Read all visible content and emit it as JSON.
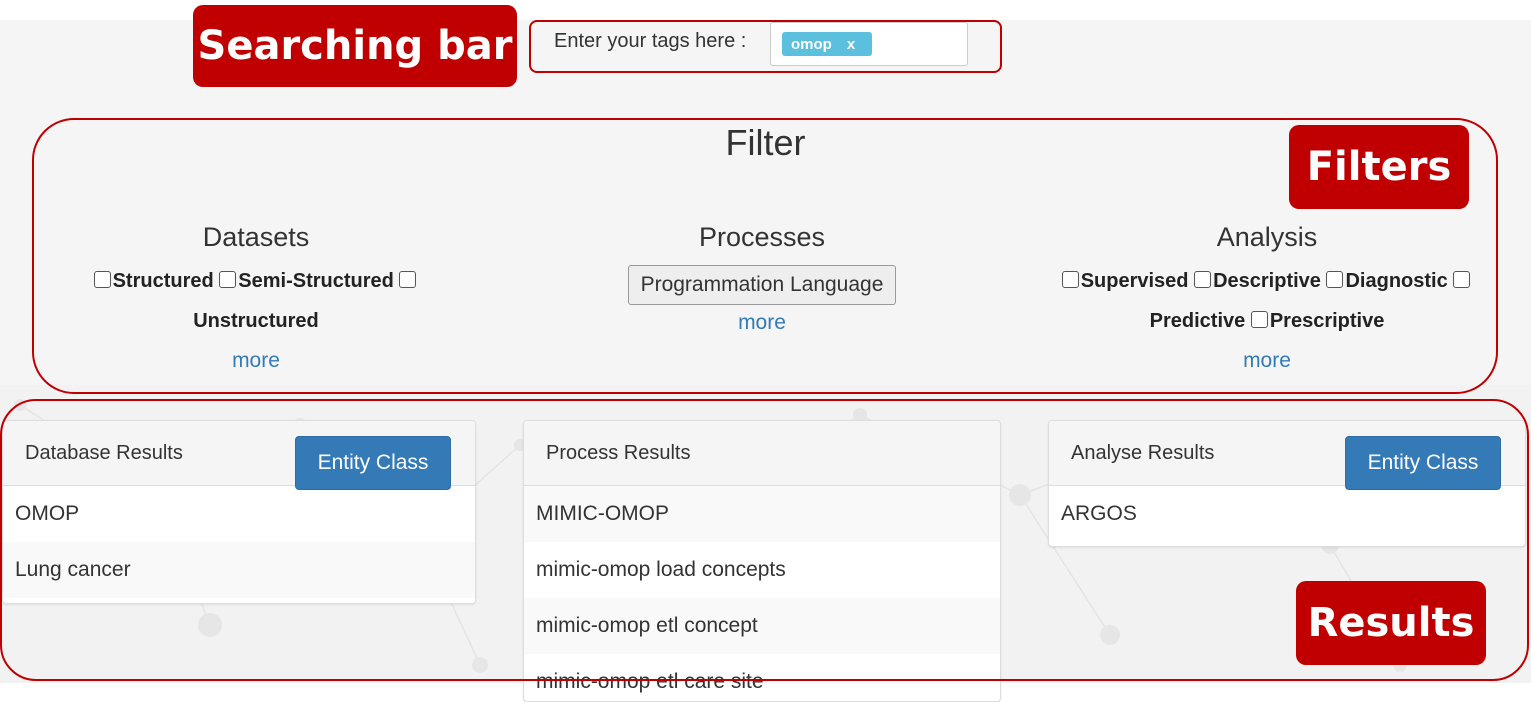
{
  "annotations": {
    "search_label": "Searching bar",
    "filters_label": "Filters",
    "results_label": "Results"
  },
  "search": {
    "prompt": "Enter your tags here :",
    "tags": [
      {
        "label": "omop",
        "remove": "x"
      }
    ]
  },
  "filter": {
    "title": "Filter",
    "datasets": {
      "title": "Datasets",
      "options": [
        "Structured",
        "Semi-Structured",
        "Unstructured"
      ],
      "more": "more"
    },
    "processes": {
      "title": "Processes",
      "button": "Programmation Language",
      "more": "more"
    },
    "analysis": {
      "title": "Analysis",
      "options": [
        "Supervised",
        "Descriptive",
        "Diagnostic",
        "Predictive",
        "Prescriptive"
      ],
      "more": "more"
    }
  },
  "results": {
    "database": {
      "title": "Database Results",
      "button": "Entity Class",
      "items": [
        "OMOP",
        "Lung cancer"
      ]
    },
    "process": {
      "title": "Process Results",
      "items": [
        "MIMIC-OMOP",
        "mimic-omop load concepts",
        "mimic-omop etl concept",
        "mimic-omop etl care site"
      ]
    },
    "analyse": {
      "title": "Analyse Results",
      "button": "Entity Class",
      "items": [
        "ARGOS"
      ]
    }
  },
  "colors": {
    "annotation_red": "#c00000",
    "primary_button": "#337ab7",
    "tag_chip": "#5bc0de",
    "link": "#337ab7"
  }
}
